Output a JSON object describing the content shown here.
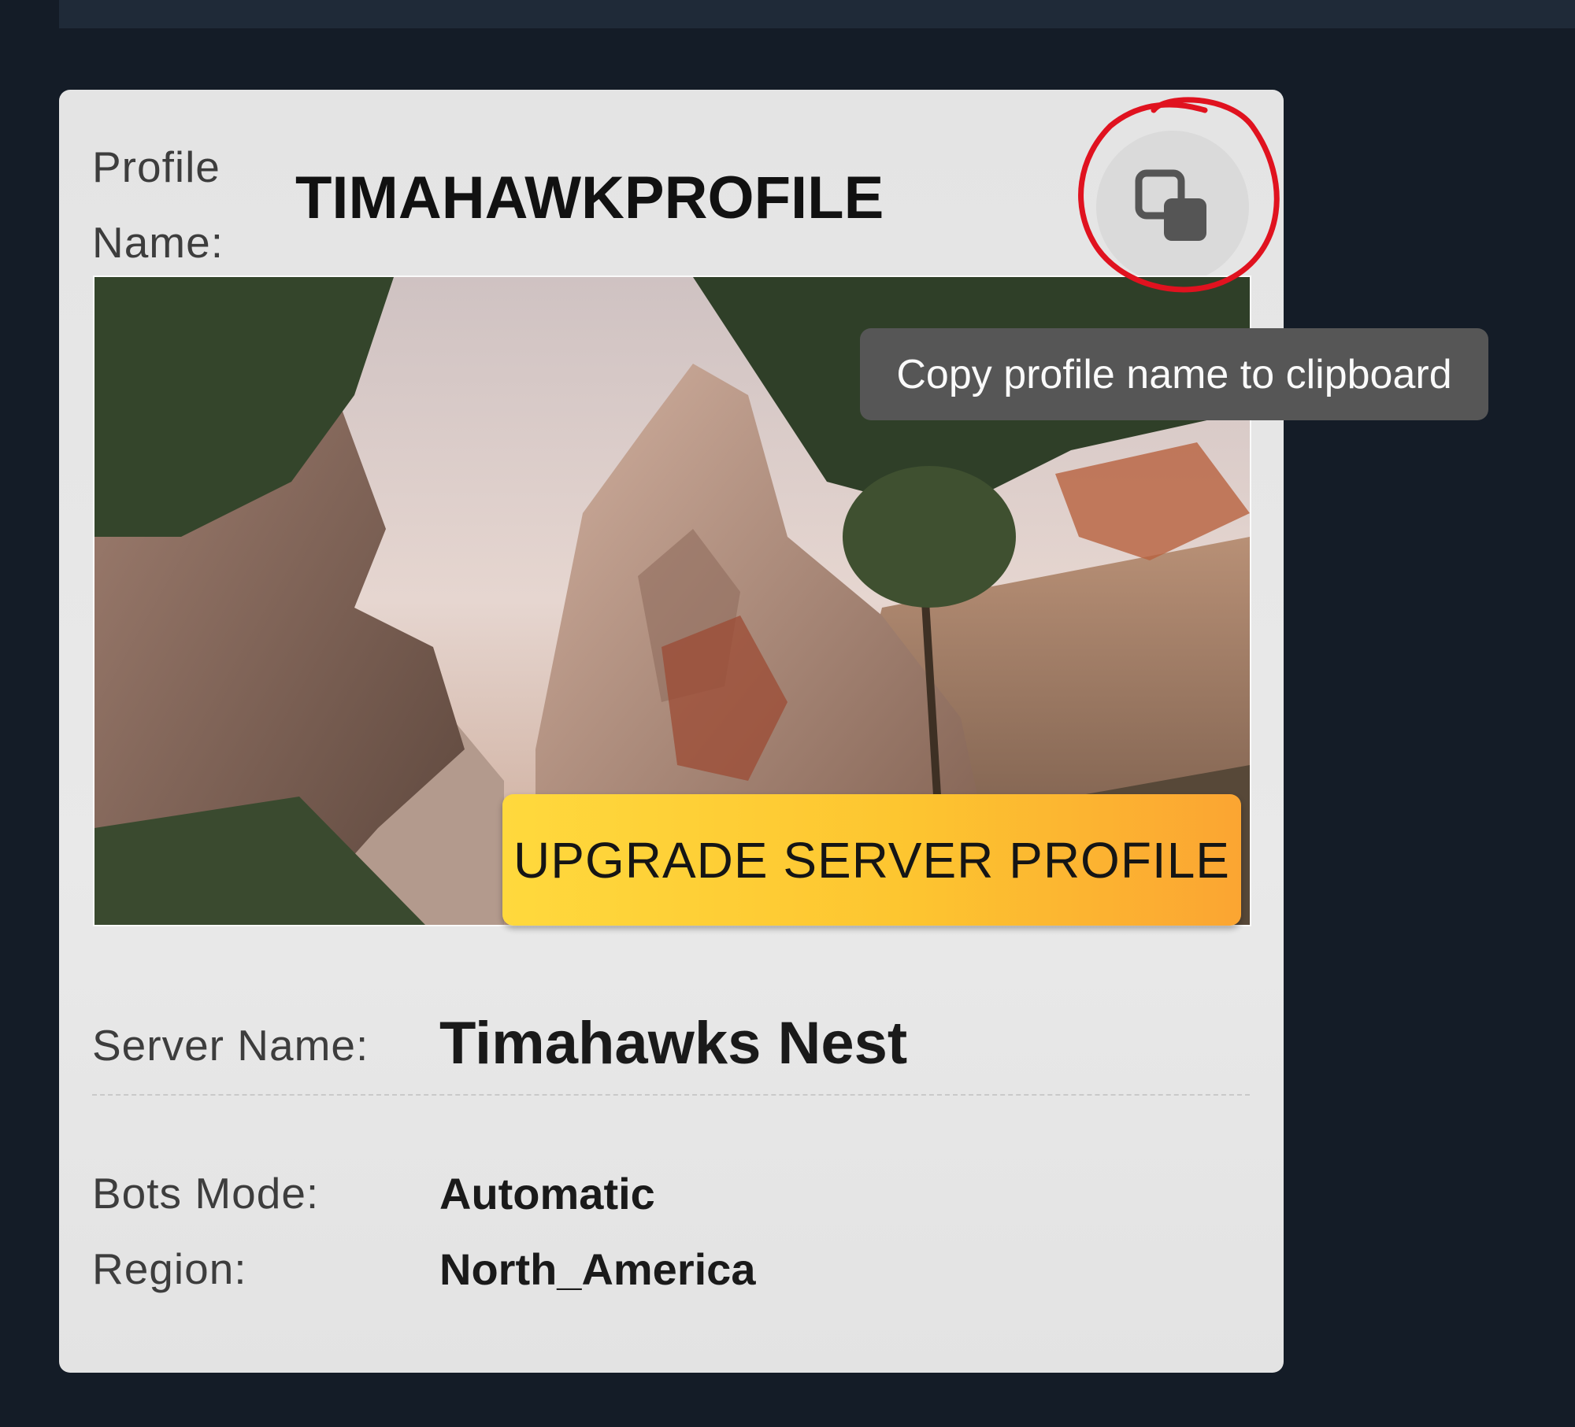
{
  "profile": {
    "label": "Profile Name:",
    "name": "TIMAHAWKPROFILE",
    "copy_tooltip": "Copy profile name to clipboard"
  },
  "upgrade_button_label": "UPGRADE SERVER PROFILE",
  "fields": {
    "server_name_label": "Server Name:",
    "server_name_value": "Timahawks Nest",
    "bots_mode_label": "Bots Mode:",
    "bots_mode_value": "Automatic",
    "region_label": "Region:",
    "region_value": "North_America"
  },
  "colors": {
    "page_background": "#141c27",
    "card_background": "#e6e6e6",
    "upgrade_gradient_start": "#ffd93d",
    "upgrade_gradient_end": "#fba532",
    "tooltip_background": "#565656",
    "annotation_circle": "#e0121f"
  },
  "icons": {
    "copy": "copy-icon"
  },
  "hero_image": "game-landscape-rocky-canyon-trees"
}
